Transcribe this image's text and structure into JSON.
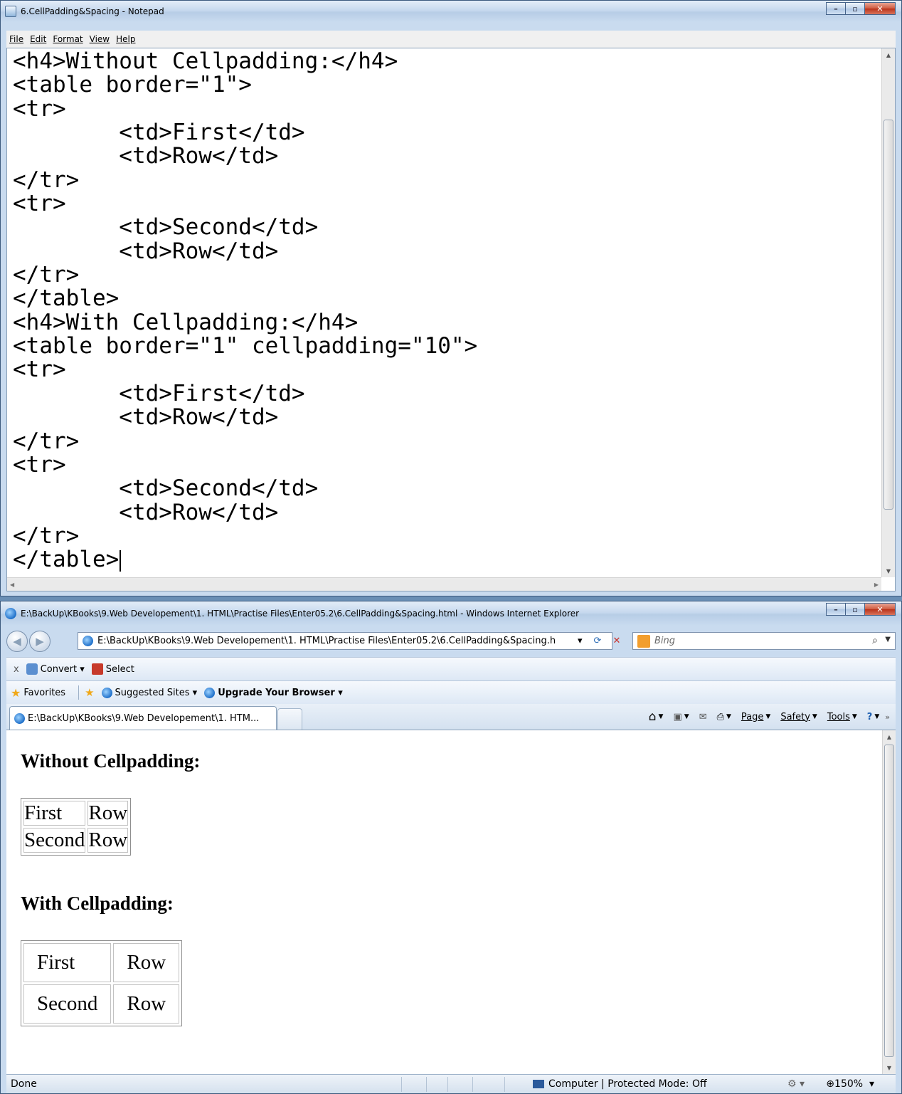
{
  "notepad": {
    "title": "6.CellPadding&Spacing - Notepad",
    "menu": [
      "File",
      "Edit",
      "Format",
      "View",
      "Help"
    ],
    "code_lines": [
      "<h4>Without Cellpadding:</h4>",
      "<table border=\"1\">",
      "<tr>",
      "        <td>First</td>",
      "        <td>Row</td>",
      "</tr>",
      "<tr>",
      "        <td>Second</td>",
      "        <td>Row</td>",
      "</tr>",
      "</table>",
      "<h4>With Cellpadding:</h4>",
      "<table border=\"1\" cellpadding=\"10\">",
      "<tr>",
      "        <td>First</td>",
      "        <td>Row</td>",
      "</tr>",
      "<tr>",
      "        <td>Second</td>",
      "        <td>Row</td>",
      "</tr>",
      "</table>"
    ]
  },
  "ie": {
    "title": "E:\\BackUp\\KBooks\\9.Web Developement\\1. HTML\\Practise Files\\Enter05.2\\6.CellPadding&Spacing.html - Windows Internet Explorer",
    "address": "E:\\BackUp\\KBooks\\9.Web Developement\\1. HTML\\Practise Files\\Enter05.2\\6.CellPadding&Spacing.h",
    "search_placeholder": "Bing",
    "toolbar": {
      "close": "x",
      "convert": "Convert",
      "select": "Select"
    },
    "favorites_bar": {
      "favorites": "Favorites",
      "suggested": "Suggested Sites",
      "upgrade": "Upgrade Your Browser"
    },
    "tab_title": "E:\\BackUp\\KBooks\\9.Web Developement\\1. HTM...",
    "commands": {
      "page": "Page",
      "safety": "Safety",
      "tools": "Tools"
    },
    "page": {
      "heading1": "Without Cellpadding:",
      "table1": [
        [
          "First",
          "Row"
        ],
        [
          "Second",
          "Row"
        ]
      ],
      "heading2": "With Cellpadding:",
      "table2": [
        [
          "First",
          "Row"
        ],
        [
          "Second",
          "Row"
        ]
      ]
    },
    "status": {
      "text": "Done",
      "zone": "Computer | Protected Mode: Off",
      "zoom": "150%"
    }
  },
  "colors": {
    "chrome": "#c9dbef",
    "close_button": "#c8452a",
    "frame": "#3c5a7e"
  },
  "icons": [
    "notepad-icon",
    "ie-icon",
    "back-icon",
    "forward-icon",
    "refresh-icon",
    "stop-icon",
    "bing-icon",
    "search-icon",
    "favorites-star-icon",
    "home-icon",
    "feeds-icon",
    "mail-icon",
    "print-icon",
    "help-icon"
  ]
}
